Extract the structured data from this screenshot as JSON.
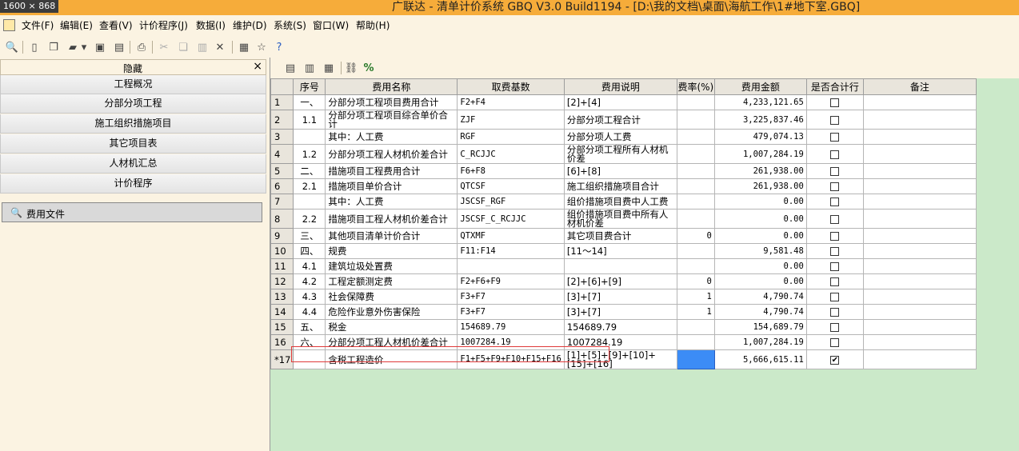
{
  "title_bar": {
    "dimensions": "1600 × 868",
    "title": "广联达 - 清单计价系统 GBQ V3.0 Build1194 - [D:\\我的文档\\桌面\\海航工作\\1#地下室.GBQ]"
  },
  "menu": [
    "文件(F)",
    "编辑(E)",
    "查看(V)",
    "计价程序(J)",
    "数据(I)",
    "维护(D)",
    "系统(S)",
    "窗口(W)",
    "帮助(H)"
  ],
  "left_panel": {
    "hide_label": "隐藏",
    "close_symbol": "×",
    "nav": [
      "工程概况",
      "分部分项工程",
      "施工组织措施项目",
      "其它项目表",
      "人材机汇总",
      "计价程序"
    ],
    "file_button": "费用文件"
  },
  "table": {
    "headers": [
      "",
      "序号",
      "费用名称",
      "取费基数",
      "费用说明",
      "费率(%)",
      "费用金额",
      "是否合计行",
      "备注"
    ],
    "rows": [
      {
        "n": "1",
        "seq": "一、",
        "name": "分部分项工程项目费用合计",
        "base": "F2+F4",
        "desc": "[2]+[4]",
        "rate": "",
        "amount": "4,233,121.65",
        "check": "☐",
        "note": ""
      },
      {
        "n": "2",
        "seq": "1.1",
        "name": "分部分项工程项目综合单价合计",
        "base": "ZJF",
        "desc": "分部分项工程合计",
        "rate": "",
        "amount": "3,225,837.46",
        "check": "☐",
        "note": ""
      },
      {
        "n": "3",
        "seq": "",
        "name": "其中：人工费",
        "base": "RGF",
        "desc": "分部分项人工费",
        "rate": "",
        "amount": "479,074.13",
        "check": "☐",
        "note": ""
      },
      {
        "n": "4",
        "seq": "1.2",
        "name": "分部分项工程人材机价差合计",
        "base": "C_RCJJC",
        "desc": "分部分项工程所有人材机价差",
        "rate": "",
        "amount": "1,007,284.19",
        "check": "☐",
        "note": ""
      },
      {
        "n": "5",
        "seq": "二、",
        "name": "措施项目工程费用合计",
        "base": "F6+F8",
        "desc": "[6]+[8]",
        "rate": "",
        "amount": "261,938.00",
        "check": "☐",
        "note": ""
      },
      {
        "n": "6",
        "seq": "2.1",
        "name": "措施项目单价合计",
        "base": "QTCSF",
        "desc": "施工组织措施项目合计",
        "rate": "",
        "amount": "261,938.00",
        "check": "☐",
        "note": ""
      },
      {
        "n": "7",
        "seq": "",
        "name": "其中：人工费",
        "base": "JSCSF_RGF",
        "desc": "组价措施项目费中人工费",
        "rate": "",
        "amount": "0.00",
        "check": "☐",
        "note": ""
      },
      {
        "n": "8",
        "seq": "2.2",
        "name": "措施项目工程人材机价差合计",
        "base": "JSCSF_C_RCJJC",
        "desc": "组价措施项目费中所有人材机价差",
        "rate": "",
        "amount": "0.00",
        "check": "☐",
        "note": ""
      },
      {
        "n": "9",
        "seq": "三、",
        "name": "其他项目清单计价合计",
        "base": "QTXMF",
        "desc": "其它项目费合计",
        "rate": "0",
        "amount": "0.00",
        "check": "☐",
        "note": ""
      },
      {
        "n": "10",
        "seq": "四、",
        "name": "规费",
        "base": "F11:F14",
        "desc": "[11～14]",
        "rate": "",
        "amount": "9,581.48",
        "check": "☐",
        "note": ""
      },
      {
        "n": "11",
        "seq": "4.1",
        "name": "建筑垃圾处置费",
        "base": "",
        "desc": "",
        "rate": "",
        "amount": "0.00",
        "check": "☐",
        "note": ""
      },
      {
        "n": "12",
        "seq": "4.2",
        "name": "工程定额测定费",
        "base": "F2+F6+F9",
        "desc": "[2]+[6]+[9]",
        "rate": "0",
        "amount": "0.00",
        "check": "☐",
        "note": ""
      },
      {
        "n": "13",
        "seq": "4.3",
        "name": "社会保障费",
        "base": "F3+F7",
        "desc": "[3]+[7]",
        "rate": "1",
        "amount": "4,790.74",
        "check": "☐",
        "note": ""
      },
      {
        "n": "14",
        "seq": "4.4",
        "name": "危险作业意外伤害保险",
        "base": "F3+F7",
        "desc": "[3]+[7]",
        "rate": "1",
        "amount": "4,790.74",
        "check": "☐",
        "note": ""
      },
      {
        "n": "15",
        "seq": "五、",
        "name": "税金",
        "base": "154689.79",
        "desc": "154689.79",
        "rate": "",
        "amount": "154,689.79",
        "check": "☐",
        "note": ""
      },
      {
        "n": "16",
        "seq": "六、",
        "name": "分部分项工程人材机价差合计",
        "base": "1007284.19",
        "desc": "1007284.19",
        "rate": "",
        "amount": "1,007,284.19",
        "check": "☐",
        "note": ""
      },
      {
        "n": "*17",
        "seq": "",
        "name": "含税工程造价",
        "base": "F1+F5+F9+F10+F15+F16",
        "desc": "[1]+[5]+[9]+[10]+[15]+[16]",
        "rate": "",
        "amount": "5,666,615.11",
        "check": "☑",
        "note": ""
      }
    ]
  }
}
